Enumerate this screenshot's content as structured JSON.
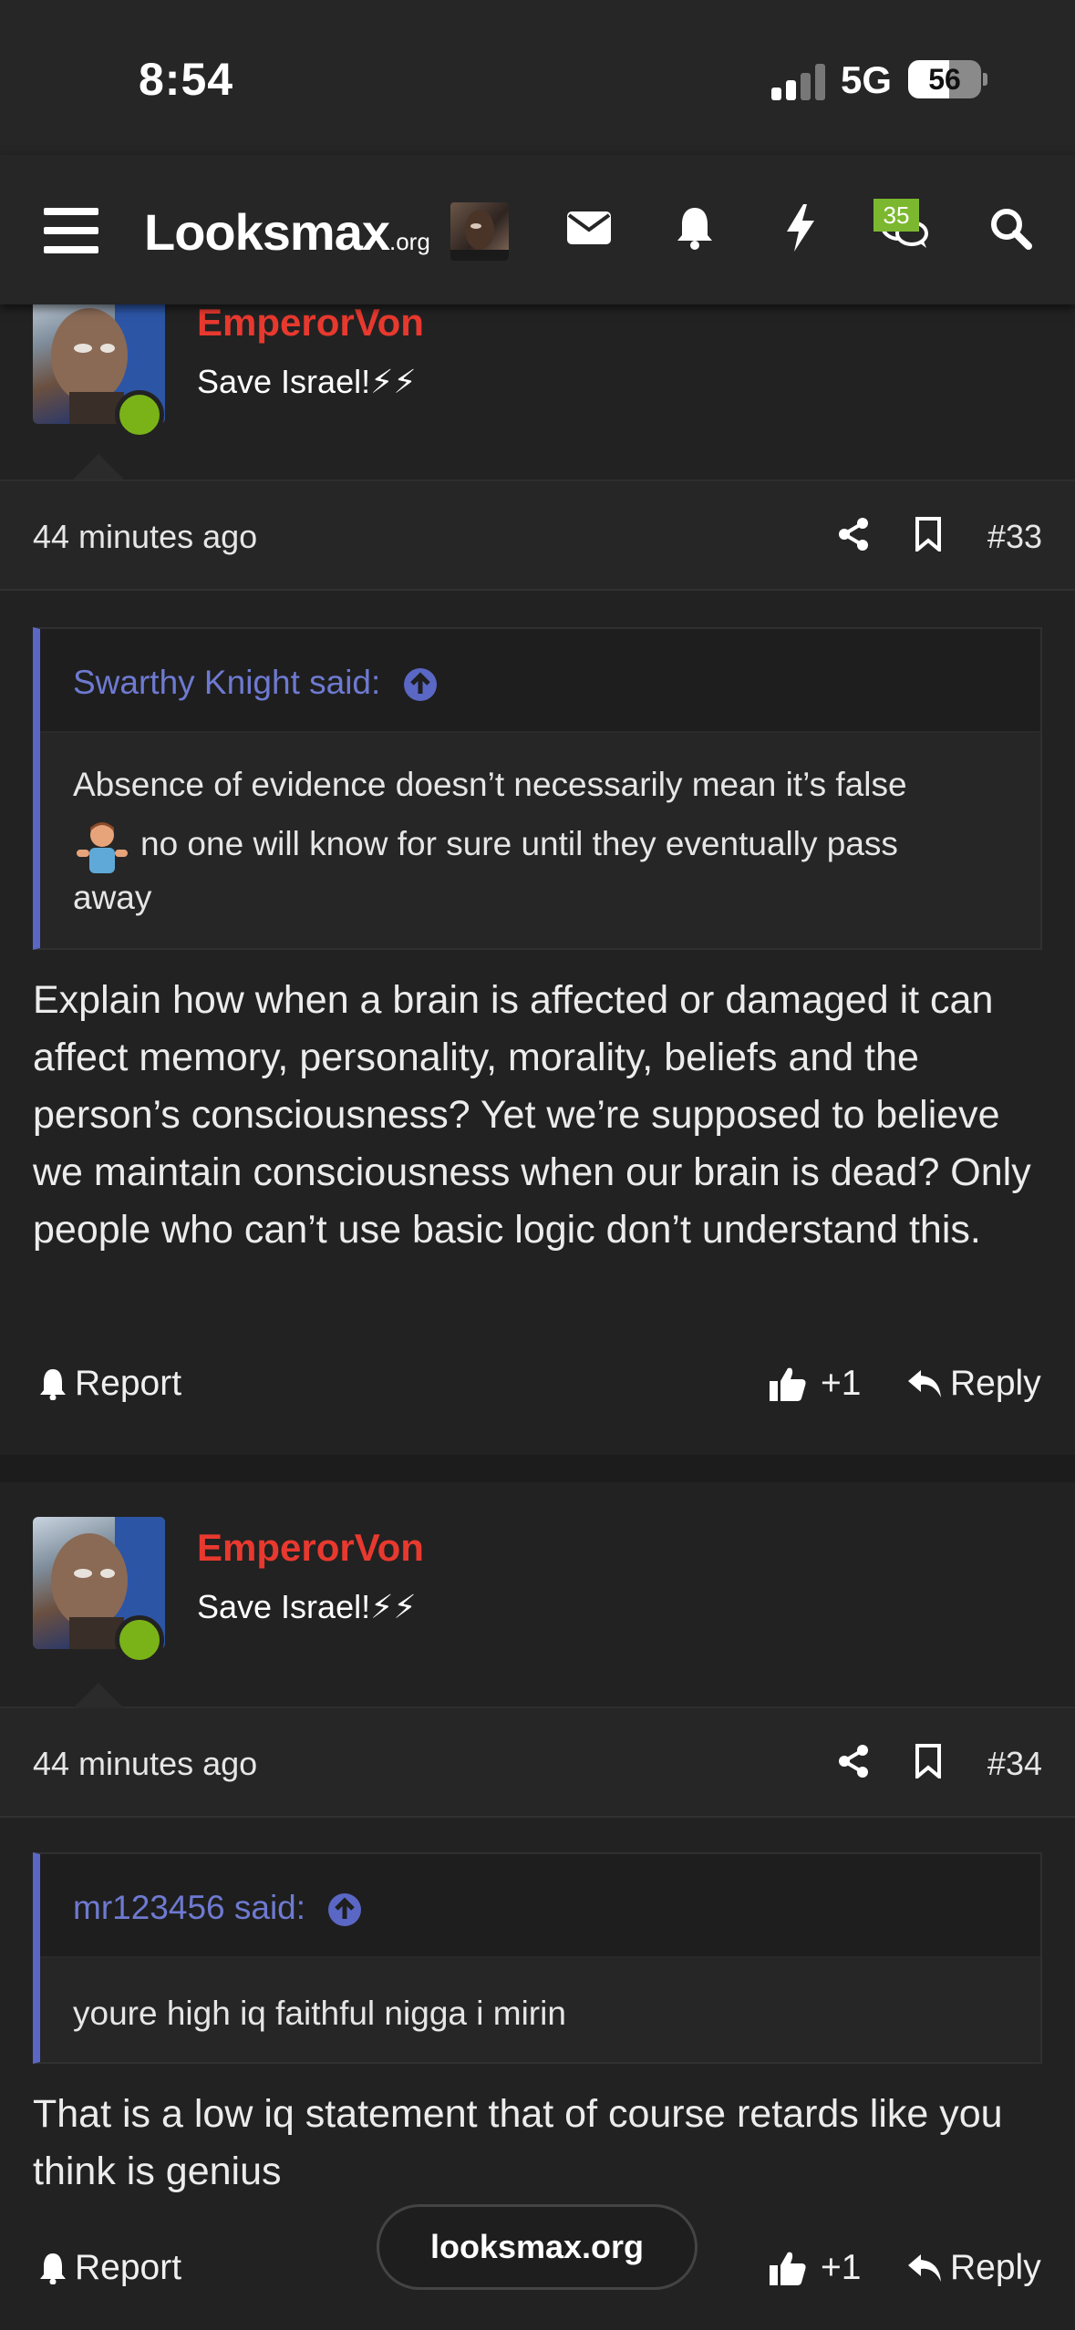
{
  "status_bar": {
    "time": "8:54",
    "network": "5G",
    "battery": "56"
  },
  "nav": {
    "logo_main": "Looksmax",
    "logo_suffix": ".org",
    "badge_count": "35"
  },
  "posts": [
    {
      "author": "EmperorVon",
      "title": "Save Israel!⚡⚡",
      "time": "44 minutes ago",
      "number": "#33",
      "quote": {
        "author": "Swarthy Knight said:",
        "text_line1": "Absence of evidence doesn’t necessarily mean it’s false",
        "text_line2": "no one will know for sure until they eventually pass",
        "text_line3": "away"
      },
      "body": "Explain how when a brain is affected or damaged it can affect memory, personality, morality, beliefs and the person’s consciousness? Yet we’re supposed to believe we maintain consciousness when our brain is dead? Only people who can’t use basic logic don’t understand this.",
      "report_label": "Report",
      "like_count": "+1",
      "reply_label": "Reply"
    },
    {
      "author": "EmperorVon",
      "title": "Save Israel!⚡⚡",
      "time": "44 minutes ago",
      "number": "#34",
      "quote": {
        "author": "mr123456 said:",
        "text_line1": "youre high iq faithful nigga i mirin"
      },
      "body": "That is a low iq statement that of course retards like you think is genius",
      "report_label": "Report",
      "like_count": "+1",
      "reply_label": "Reply"
    }
  ],
  "floating_domain": "looksmax.org",
  "colors": {
    "author": "#e8392f",
    "quote_author": "#6e7ad1",
    "online": "#7ab317",
    "badge": "#7cb82f"
  }
}
